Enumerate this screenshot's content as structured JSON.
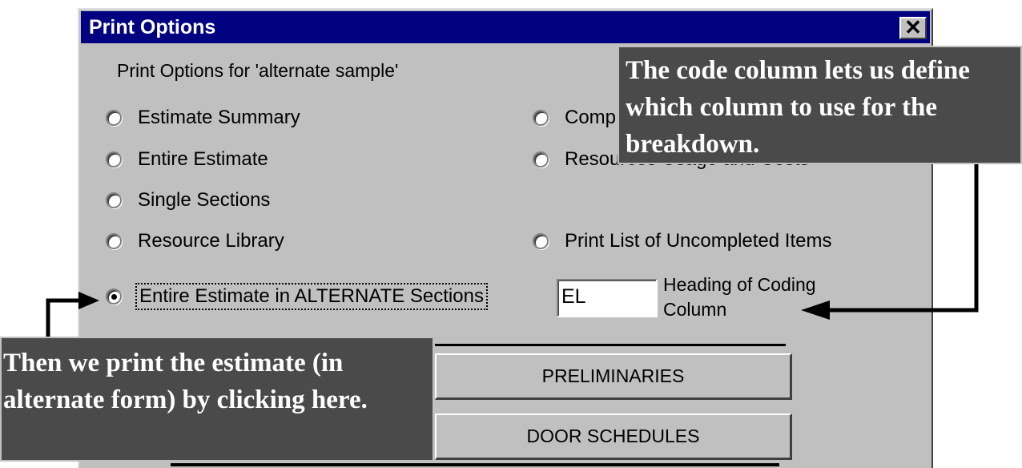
{
  "window": {
    "title": "Print Options",
    "close_label": "✕"
  },
  "subtitle": "Print Options for 'alternate sample'",
  "options": {
    "estimate_summary": "Estimate Summary",
    "entire_estimate": "Entire Estimate",
    "single_sections": "Single Sections",
    "resource_library": "Resource Library",
    "alternate_sections": "Entire Estimate in ALTERNATE Sections",
    "comp_partial": "Comp",
    "resources_partial": "Resources Usage and Costs",
    "uncompleted_items": "Print List of Uncompleted Items",
    "selected": "alternate_sections"
  },
  "coding": {
    "value": "EL",
    "label": "Heading of Coding Column"
  },
  "buttons": {
    "preliminaries": "PRELIMINARIES",
    "door_schedules": "DOOR SCHEDULES"
  },
  "annotations": {
    "code_column": "The code column lets us define which column to use for the breakdown.",
    "print_estimate": "Then we print the estimate (in alternate form) by clicking here."
  },
  "colors": {
    "titlebar": "#000080",
    "dialog": "#c0c0c0",
    "callout": "#4a4a4a"
  }
}
